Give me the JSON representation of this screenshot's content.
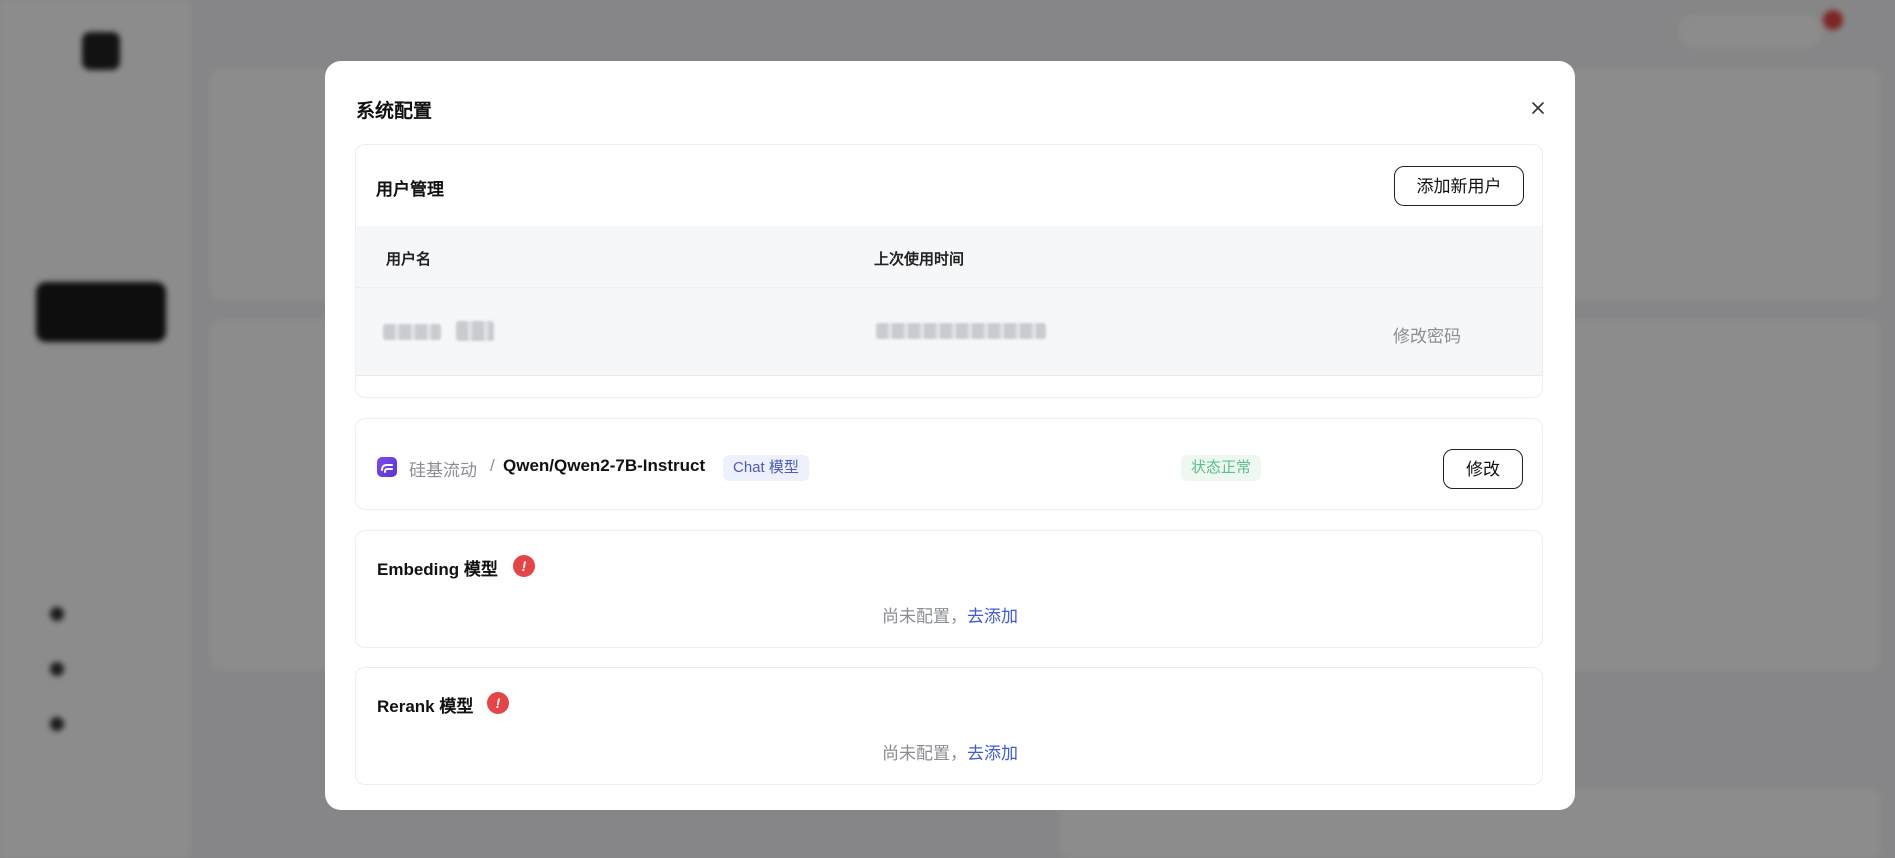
{
  "modal": {
    "title": "系统配置"
  },
  "user_management": {
    "title": "用户管理",
    "add_user_label": "添加新用户",
    "columns": [
      "用户名",
      "上次使用时间"
    ],
    "rows": [
      {
        "action_label": "修改密码"
      }
    ]
  },
  "chat_model": {
    "provider": "硅基流动",
    "separator": "/",
    "model_name": "Qwen/Qwen2-7B-Instruct",
    "type_chip": "Chat 模型",
    "status": "状态正常",
    "edit_label": "修改"
  },
  "embedding_model": {
    "title": "Embeding 模型",
    "warning_glyph": "!",
    "empty_text": "尚未配置，",
    "add_link": "去添加"
  },
  "rerank_model": {
    "title": "Rerank 模型",
    "warning_glyph": "!",
    "empty_text": "尚未配置，",
    "add_link": "去添加"
  },
  "colors": {
    "accent_link": "#3c5bd6",
    "warning": "#e54545",
    "status_ok": "#59c08a",
    "chip_chat_text": "#4a5bb8"
  },
  "icons": {
    "close": "close-icon",
    "provider": "siliconflow-logo-icon",
    "warning": "warning-icon"
  }
}
